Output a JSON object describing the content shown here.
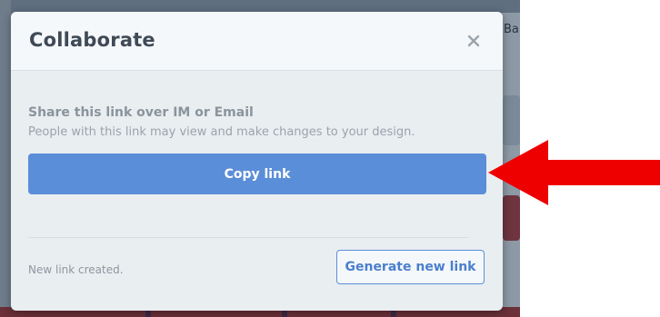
{
  "dialog": {
    "title": "Collaborate",
    "close_icon": "close-icon",
    "share_heading": "Share this link over IM or Email",
    "share_description": "People with this link may view and make changes to your design.",
    "copy_button_label": "Copy link",
    "status_text": "New link created.",
    "generate_button_label": "Generate new link"
  },
  "background": {
    "partial_text": "Ba"
  },
  "colors": {
    "primary_button": "#5b8ed8",
    "annotation_arrow": "#ee0000"
  }
}
